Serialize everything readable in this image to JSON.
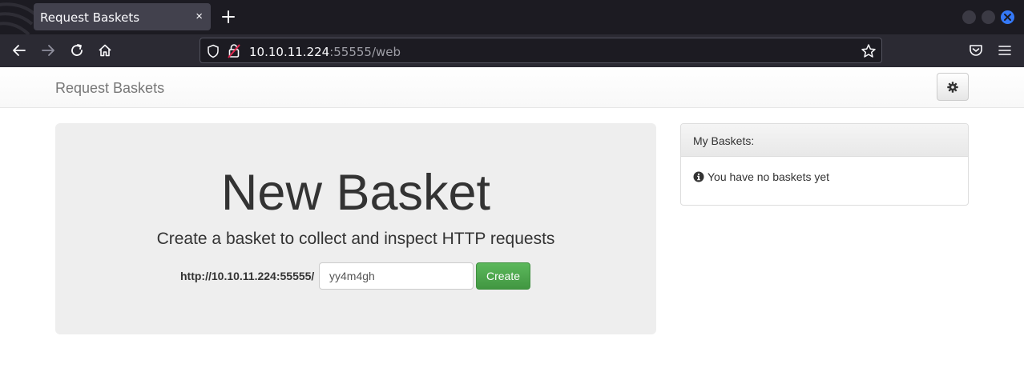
{
  "browser": {
    "tab_title": "Request Baskets",
    "tab_close": "×",
    "url_host": "10.10.11.224",
    "url_rest": ":55555/web",
    "window_buttons": [
      "minimize",
      "maximize",
      "close"
    ]
  },
  "navbar": {
    "brand": "Request Baskets",
    "settings_icon": "gear-icon"
  },
  "jumbotron": {
    "heading": "New Basket",
    "lead": "Create a basket to collect and inspect HTTP requests",
    "url_prefix": "http://10.10.11.224:55555/",
    "basket_name_value": "yy4m4gh",
    "create_label": "Create"
  },
  "baskets_panel": {
    "heading": "My Baskets:",
    "empty_text": "You have no baskets yet",
    "icon": "info-circle-icon"
  },
  "colors": {
    "create_button": "#5cb85c",
    "jumbotron_bg": "#eeeeee",
    "close_window": "#3478f6"
  }
}
